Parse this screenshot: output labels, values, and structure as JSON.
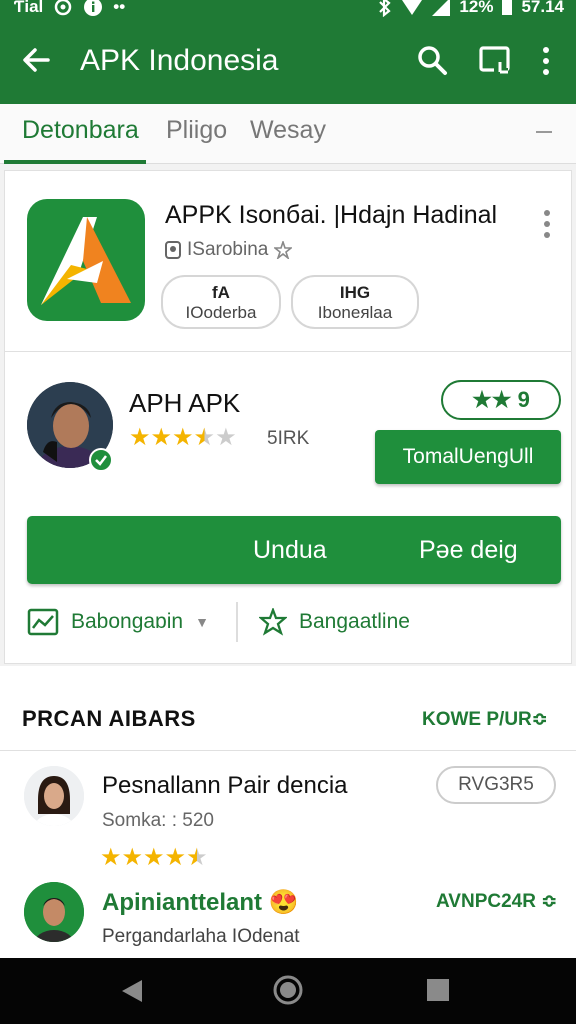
{
  "status_bar": {
    "carrier": "Ƭiаl",
    "battery": "12%",
    "time": "57.14"
  },
  "app_bar": {
    "title": "APK Indonesia"
  },
  "tabs": [
    {
      "label": "Detonbara",
      "active": true
    },
    {
      "label": "Pliigo",
      "active": false
    },
    {
      "label": "Wesay",
      "active": false
    }
  ],
  "app_card": {
    "name": "APPK Isonбai. |Hdajn Hadinal",
    "developer": "ISarobina",
    "chips": [
      {
        "line1": "fA",
        "line2": "IOoderba"
      },
      {
        "line1": "IHG",
        "line2": "Iboneяlaa"
      }
    ]
  },
  "developer_card": {
    "name": "APH APK",
    "rating": 3.5,
    "rating_count": "5IRK",
    "rating_badge_stars": "★★",
    "rating_badge_value": "9",
    "follow_label": "TomalUengUll",
    "download_label": "Undua",
    "size_label": "Pəe deig",
    "link_left": "Babongaɒin",
    "link_right": "Bangaatline"
  },
  "reviews_section": {
    "title": "PRCAN AIBARS",
    "see_all": "KOWE P/UR≎",
    "reviews": [
      {
        "name": "Pesnallann Pair dencia",
        "meta": "Somka: : 520",
        "rating": 4.5,
        "chip": "RVG3R5"
      },
      {
        "name": "Apinianttelant",
        "emoji": "😍",
        "meta": "Pergandarlaha IOdenat",
        "chip": "AVNPC24R ≎"
      }
    ]
  },
  "colors": {
    "primary": "#1f7a35",
    "button": "#1f8f3c",
    "star": "#f4b400",
    "star_empty": "#cccccc"
  }
}
